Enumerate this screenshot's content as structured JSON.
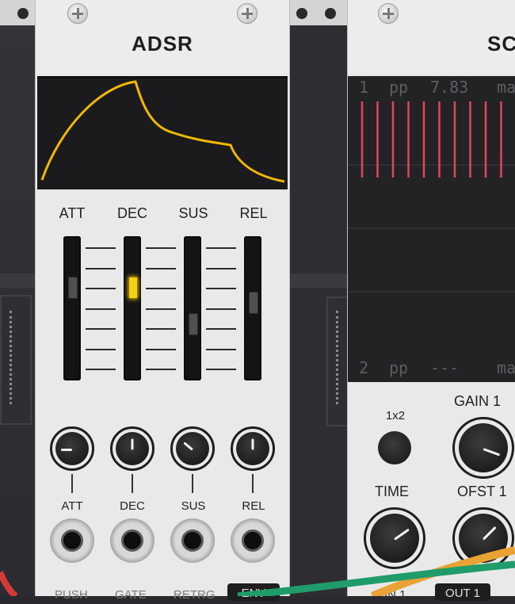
{
  "adsr": {
    "title": "ADSR",
    "slider_labels": [
      "ATT",
      "DEC",
      "SUS",
      "REL"
    ],
    "knob_labels": [
      "ATT",
      "DEC",
      "SUS",
      "REL"
    ],
    "bottom_labels": [
      "PUSH",
      "GATE",
      "RETRG",
      "ENV"
    ],
    "envelope_color": "#f2b807",
    "active_slider_color": "#f4d012",
    "slider_levels": [
      0.67,
      0.67,
      0.38,
      0.55
    ]
  },
  "scope": {
    "title": "SC",
    "ch1_number": "1",
    "ch1_mode": "pp",
    "ch1_value": "7.83",
    "ch1_extra": "ma",
    "ch2_number": "2",
    "ch2_mode": "pp",
    "ch2_value": "---",
    "ch2_extra": "ma",
    "trace_color": "#e0465a",
    "button_label": "1x2",
    "gain_label": "GAIN 1",
    "time_label": "TIME",
    "offset_label": "OFST 1",
    "in_label": "IN 1",
    "out_label": "OUT 1"
  },
  "cables": {
    "green": "#1f9c6a",
    "orange": "#e9a234",
    "red": "#d23a3a"
  }
}
